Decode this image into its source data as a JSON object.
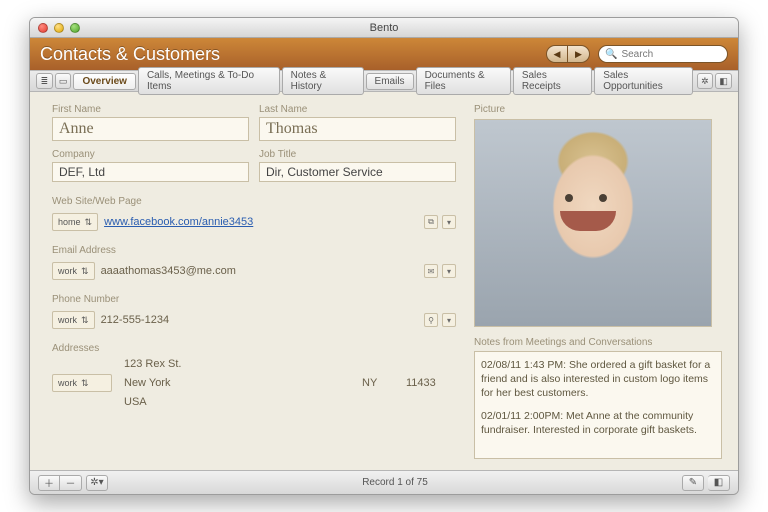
{
  "window": {
    "title": "Bento"
  },
  "header": {
    "title": "Contacts & Customers",
    "search_placeholder": "Search"
  },
  "tabs": [
    "Overview",
    "Calls, Meetings & To-Do Items",
    "Notes & History",
    "Emails",
    "Documents & Files",
    "Sales Receipts",
    "Sales Opportunities"
  ],
  "active_tab": "Overview",
  "labels": {
    "first_name": "First Name",
    "last_name": "Last Name",
    "company": "Company",
    "job_title": "Job Title",
    "website": "Web Site/Web Page",
    "email": "Email Address",
    "phone": "Phone Number",
    "addresses": "Addresses",
    "picture": "Picture",
    "notes": "Notes from Meetings and Conversations"
  },
  "contact": {
    "first_name": "Anne",
    "last_name": "Thomas",
    "company": "DEF, Ltd",
    "job_title": "Dir, Customer Service",
    "website": {
      "tag": "home",
      "url": "www.facebook.com/annie3453"
    },
    "email": {
      "tag": "work",
      "value": "aaaathomas3453@me.com"
    },
    "phone": {
      "tag": "work",
      "value": "212-555-1234"
    },
    "address": {
      "tag": "work",
      "street": "123 Rex St.",
      "city": "New York",
      "state": "NY",
      "zip": "11433",
      "country": "USA"
    }
  },
  "notes": [
    "02/08/11 1:43 PM: She ordered a gift basket for a friend and is also interested in custom logo items for her best customers.",
    "02/01/11 2:00PM:  Met Anne at the community fundraiser.  Interested in corporate gift baskets."
  ],
  "footer": {
    "status": "Record 1 of 75"
  }
}
